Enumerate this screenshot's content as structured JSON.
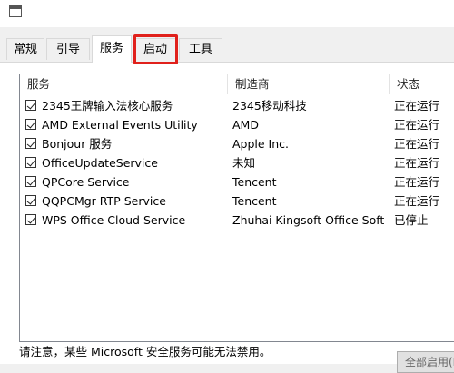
{
  "tabs": [
    {
      "label": "常规"
    },
    {
      "label": "引导"
    },
    {
      "label": "服务"
    },
    {
      "label": "启动"
    },
    {
      "label": "工具"
    }
  ],
  "active_tab": "服务",
  "highlighted_tab": "启动",
  "highlight_color": "#e0201b",
  "columns": {
    "name": "服务",
    "maker": "制造商",
    "status": "状态"
  },
  "services": [
    {
      "name": "2345王牌输入法核心服务",
      "maker": "2345移动科技",
      "status": "正在运行",
      "checked": true
    },
    {
      "name": "AMD External Events Utility",
      "maker": "AMD",
      "status": "正在运行",
      "checked": true
    },
    {
      "name": "Bonjour 服务",
      "maker": "Apple Inc.",
      "status": "正在运行",
      "checked": true
    },
    {
      "name": "OfficeUpdateService",
      "maker": "未知",
      "status": "正在运行",
      "checked": true
    },
    {
      "name": "QPCore Service",
      "maker": "Tencent",
      "status": "正在运行",
      "checked": true
    },
    {
      "name": "QQPCMgr RTP Service",
      "maker": "Tencent",
      "status": "正在运行",
      "checked": true
    },
    {
      "name": "WPS Office Cloud Service",
      "maker": "Zhuhai Kingsoft Office Soft...",
      "status": "已停止",
      "checked": true
    }
  ],
  "footer_note": "请注意，某些 Microsoft 安全服务可能无法禁用。",
  "enable_all_label": "全部启用(E)"
}
